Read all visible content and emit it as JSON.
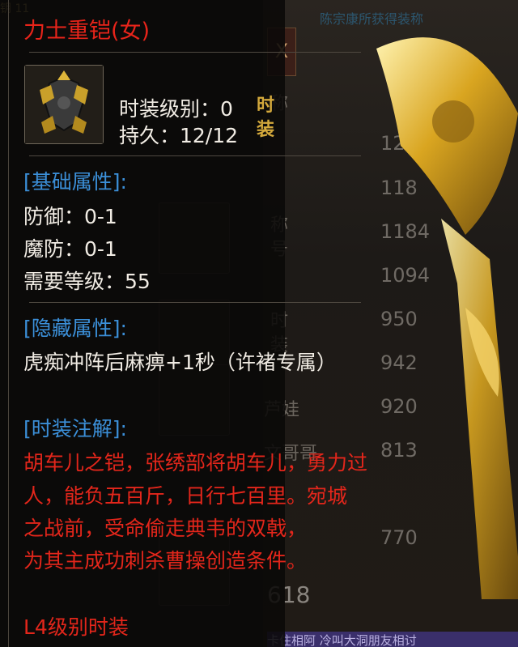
{
  "tooltip": {
    "title": "力士重铠(女)",
    "level_line": "时装级别：0",
    "durability_line": "持久：12/12",
    "stamp_top": "时",
    "stamp_bottom": "装",
    "basic_header": "[基础属性]:",
    "defense": "防御：0-1",
    "magic_defense": "魔防：0-1",
    "required_level": "需要等级：55",
    "hidden_header": "[隐藏属性]:",
    "hidden_effect": "虎痴冲阵后麻痹+1秒（许褚专属）",
    "note_header": "[时装注解]:",
    "note_lines": [
      "胡车儿之铠，张绣部将胡车儿，勇力过",
      "人，能负五百斤，日行七百里。宛城",
      "之战前，受命偷走典韦的双戟，",
      "为其主成功刺杀曹操创造条件。"
    ],
    "footer": "L4级别时装"
  },
  "background": {
    "header_fragment": "陈宗康所获得装称",
    "column_chars": [
      "称",
      "装",
      "备",
      "衫",
      "称",
      "号",
      "壹",
      "时",
      "装",
      "娃",
      "哥"
    ],
    "row_values": [
      "12",
      "118",
      "1184",
      "1094",
      "950",
      "942",
      "920",
      "813",
      "770"
    ],
    "row_names": [
      "",
      "",
      "呼",
      "壹",
      "",
      "",
      "芦娃",
      "文哥哥",
      ""
    ],
    "bottom_value": "618",
    "close_label": "X",
    "bottom_strip": "卡住相阿 冷叫大洞朋友相讨"
  },
  "colors": {
    "title": "#e8241a",
    "header": "#3b8fd8",
    "body_text": "#f1ece4",
    "stamp": "#d4a93c"
  }
}
